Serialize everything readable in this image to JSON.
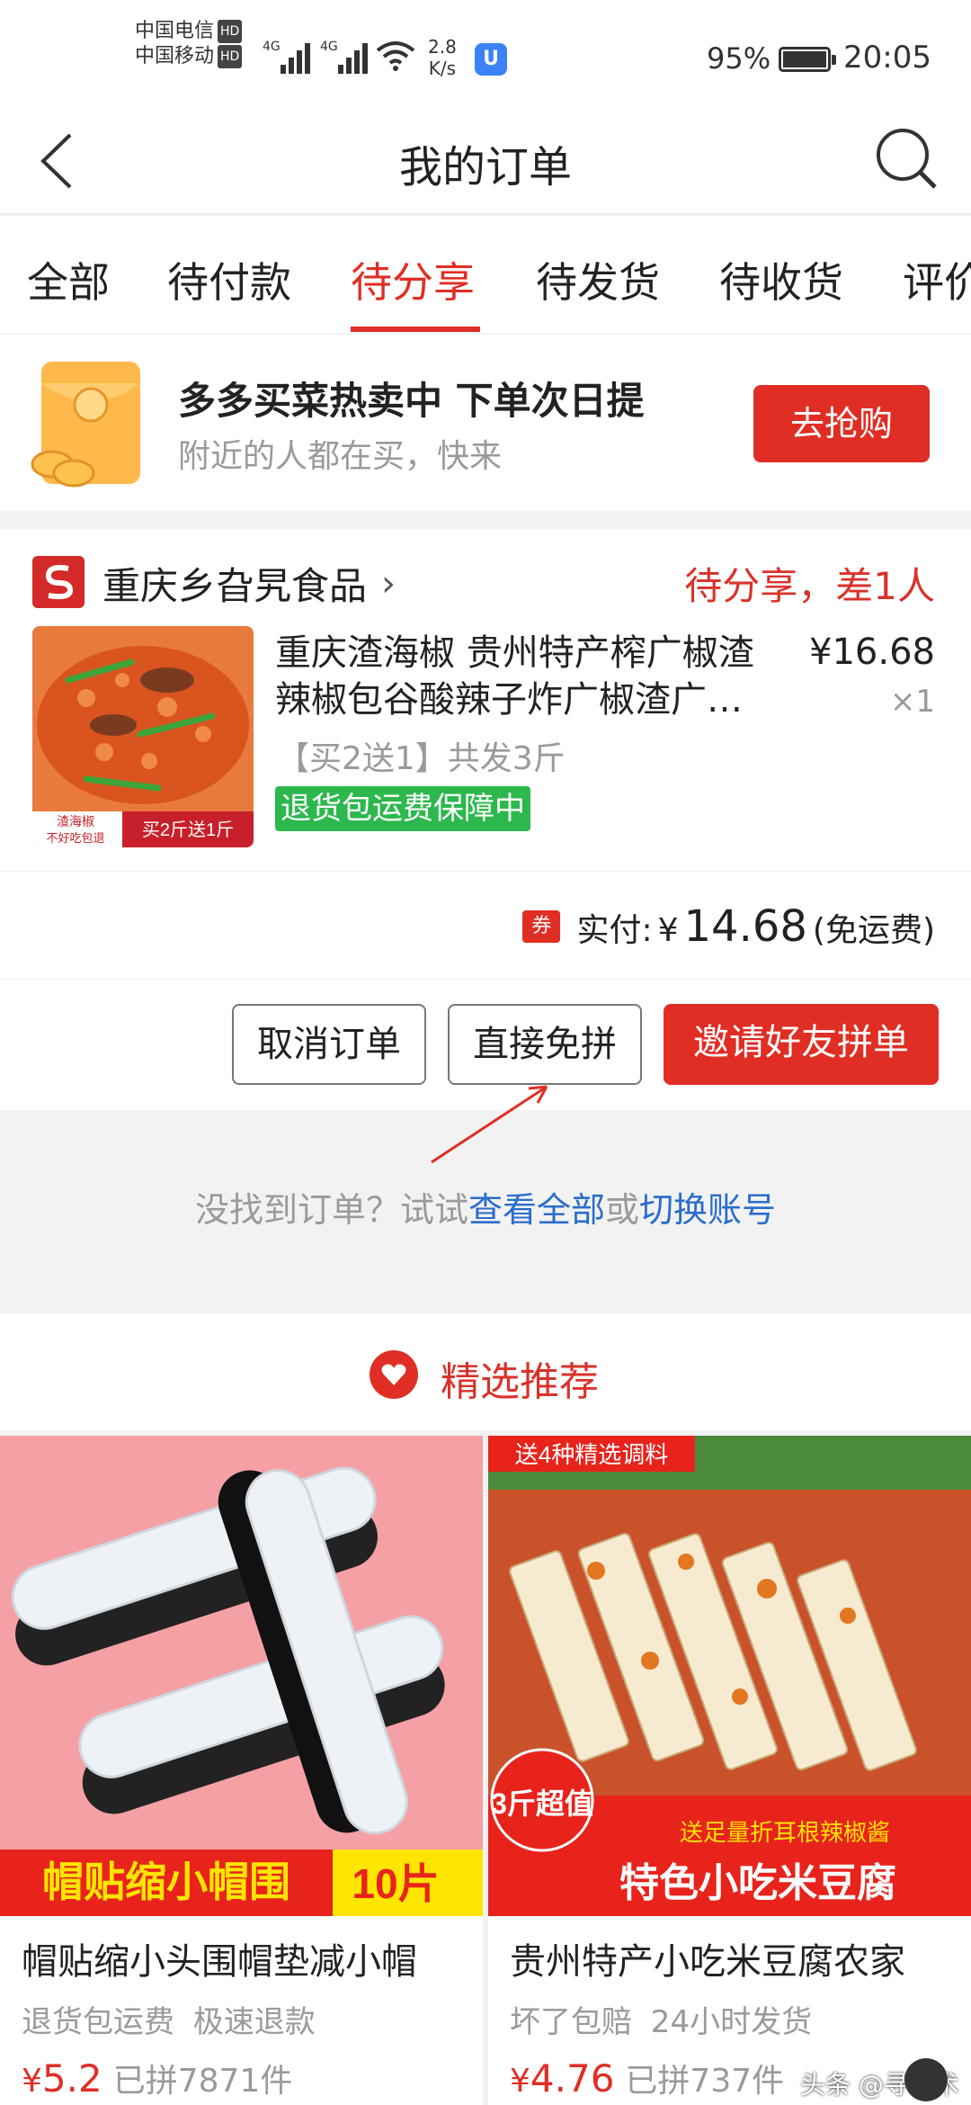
{
  "status_bar": {
    "carrier1": "中国电信",
    "carrier2": "中国移动",
    "hd": "HD",
    "net": "4G",
    "speed_value": "2.8",
    "speed_unit": "K/s",
    "battery": "95%",
    "time": "20:05"
  },
  "header": {
    "title": "我的订单"
  },
  "tabs": [
    {
      "label": "全部"
    },
    {
      "label": "待付款"
    },
    {
      "label": "待分享",
      "active": true
    },
    {
      "label": "待发货"
    },
    {
      "label": "待收货"
    },
    {
      "label": "评价"
    }
  ],
  "promo": {
    "title": "多多买菜热卖中 下单次日提",
    "subtitle": "附近的人都在买，快来",
    "button": "去抢购"
  },
  "order": {
    "shop_name": "重庆乡旮旯食品",
    "status": "待分享，差1人",
    "product_title": "重庆渣海椒 贵州特产榨广椒渣辣椒包谷酸辣子炸广椒渣广…",
    "price": "¥16.68",
    "qty": "×1",
    "spec": "【买2送1】共发3斤",
    "guarantee": "退货包运费保障中",
    "image_caption1": "渣海椒",
    "image_caption2": "不好吃包退",
    "image_badge": "买2斤送1斤",
    "coupon_label": "券",
    "paid_label": "实付:",
    "paid_currency": "¥",
    "paid_amount": "14.68",
    "shipping": "(免运费)",
    "buttons": {
      "cancel": "取消订单",
      "direct": "直接免拼",
      "invite": "邀请好友拼单"
    }
  },
  "not_found": {
    "prefix": "没找到订单？试试",
    "link1": "查看全部",
    "middle": "或",
    "link2": "切换账号"
  },
  "recommend": {
    "title": "精选推荐",
    "items": [
      {
        "title": "帽贴缩小头围帽垫减小帽",
        "tags": "退货包运费 极速退款",
        "currency": "¥",
        "price": "5.2",
        "sold": "已拼7871件",
        "banner": "帽贴缩小帽围",
        "banner_count": "10片"
      },
      {
        "title": "贵州特产小吃米豆腐农家",
        "tags": "坏了包赔 24小时发货",
        "currency": "¥",
        "price": "4.76",
        "sold": "已拼737件",
        "top_label": "送4种精选调料",
        "badge": "3斤超值",
        "sub_banner": "送足量折耳根辣椒酱",
        "banner": "特色小吃米豆腐"
      }
    ]
  },
  "watermark": "头条 @寻艺术",
  "colors": {
    "accent": "#e02e24",
    "link": "#2a6dcc",
    "green": "#2db84d"
  }
}
